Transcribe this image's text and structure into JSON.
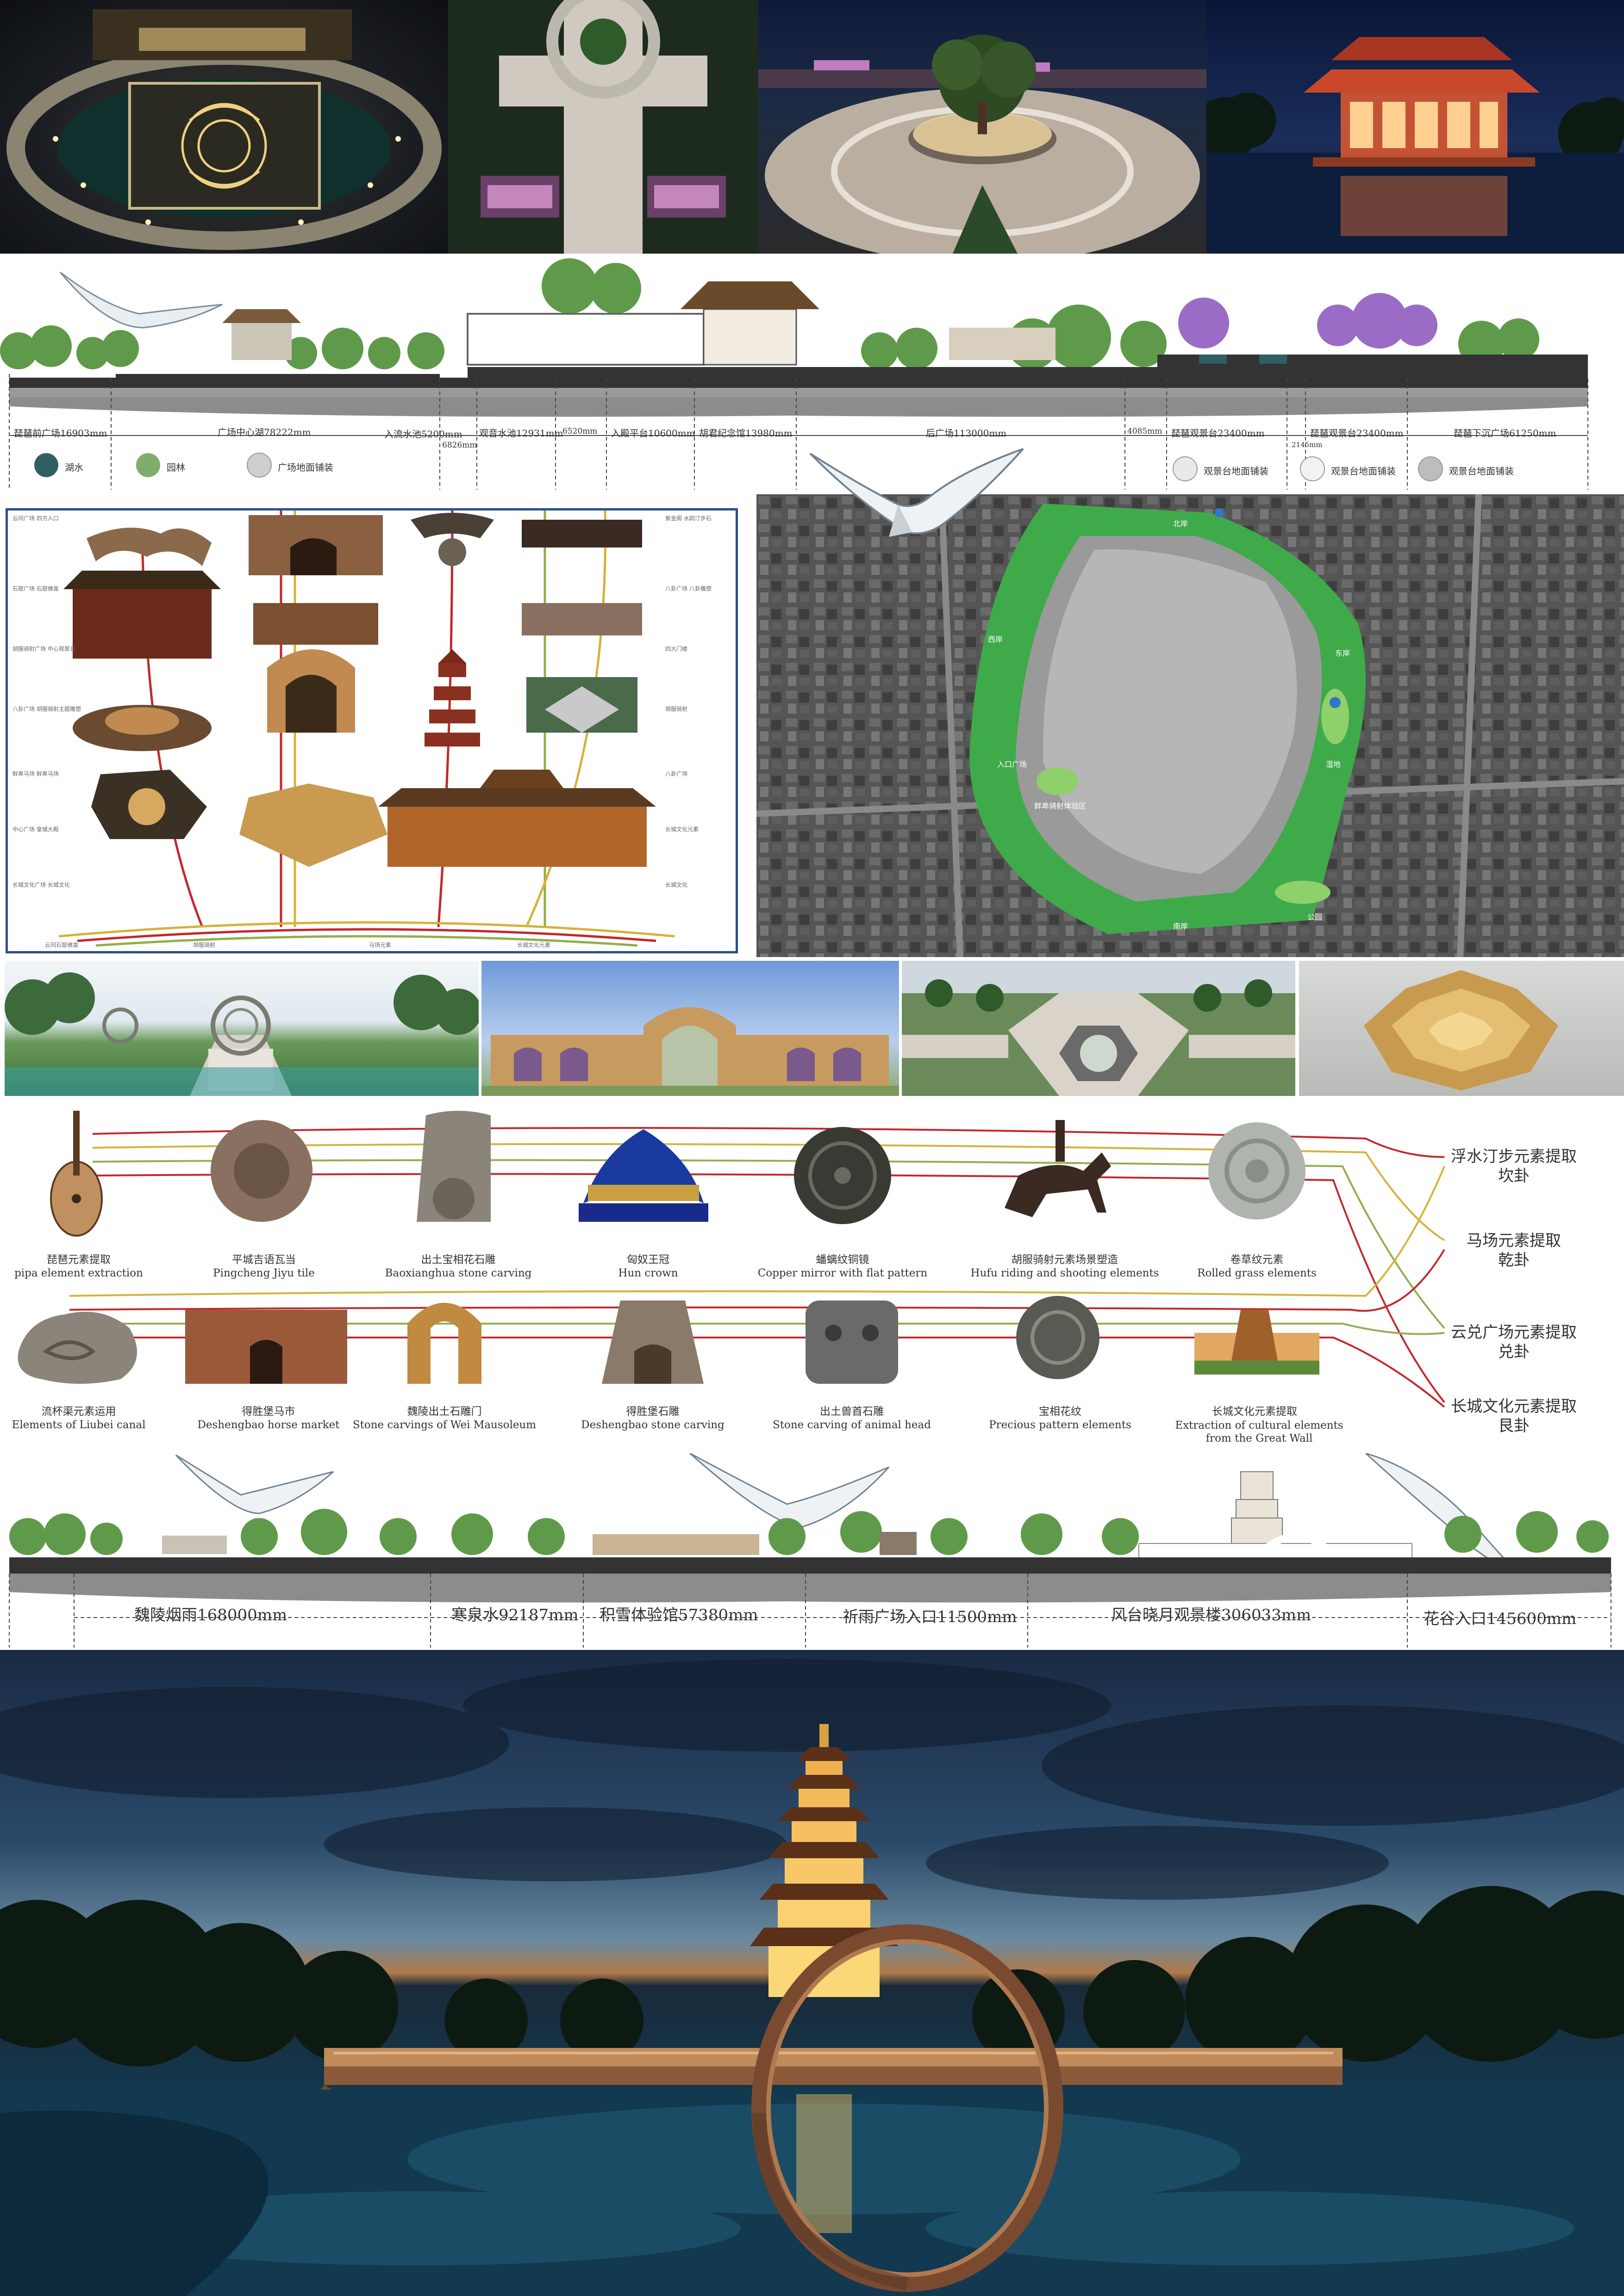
{
  "top_renders": [
    {
      "name": "pipa-plaza-night"
    },
    {
      "name": "axis-walkway-night"
    },
    {
      "name": "round-planter-plaza"
    },
    {
      "name": "red-pavilion-night"
    }
  ],
  "section_top": {
    "labels": [
      "琵琶前广场16903mm",
      "广场中心湖78222mm",
      "入流水池5200mm",
      "6826mm",
      "观音水池12931mm",
      "6520mm",
      "入殿平台10600mm",
      "胡君纪念馆13980mm",
      "后广场113000mm",
      "4085mm",
      "琵琶观景台23400mm",
      "2145mm",
      "琵琶观景台23400mm",
      "琵琶下沉广场61250mm"
    ],
    "legend": [
      {
        "label": "湖水",
        "color": "#2f5f63"
      },
      {
        "label": "园林",
        "color": "#7fae6c"
      },
      {
        "label": "广场地面铺装",
        "color": "#cfcfcf"
      },
      {
        "label": "观景台地面铺装",
        "color": "#e9e9e9"
      },
      {
        "label": "观景台地面铺装",
        "color": "#f2f2f2"
      },
      {
        "label": "观景台地面铺装",
        "color": "#bdbdbd"
      }
    ]
  },
  "element_diagram": {
    "left_labels": [
      "云冈广场 四方入口",
      "石窟广场 石窟佛龛",
      "胡服骑射广场 中心观景台",
      "八卦广场 胡服骑射主题雕塑",
      "鲜卑马场 鲜卑马场",
      "中心广场 皇城大殿",
      "长城文化广场 长城文化"
    ],
    "right_labels": [
      "紫金阁 水韵汀步石",
      "八卦广场 八卦雕塑",
      "四大门楼",
      "胡服骑射",
      "八卦广场",
      "长城文化元素",
      "长城文化"
    ],
    "bottom_labels": [
      "云冈石窟佛龛",
      "胡服骑射",
      "马场元素",
      "长城文化元素"
    ]
  },
  "map": {
    "labels": [
      "东岸",
      "西岸",
      "入口广场",
      "鲜卑骑射体验区",
      "湿地",
      "公园",
      "北岸",
      "南岸"
    ]
  },
  "mid_renders": [
    {
      "name": "armillary-walkway"
    },
    {
      "name": "arched-wall"
    },
    {
      "name": "octagon-plaza"
    },
    {
      "name": "bagua-sculpture"
    }
  ],
  "artifacts_row1": [
    {
      "cn": "琵琶元素提取",
      "en": "pipa element extraction"
    },
    {
      "cn": "平城吉语瓦当",
      "en": "Pingcheng Jiyu tile"
    },
    {
      "cn": "出土宝相花石雕",
      "en": "Baoxianghua stone carving"
    },
    {
      "cn": "匈奴王冠",
      "en": "Hun crown"
    },
    {
      "cn": "蟠螭纹铜镜",
      "en": "Copper mirror with flat pattern"
    },
    {
      "cn": "胡服骑射元素场景塑造",
      "en": "Hufu riding and shooting elements"
    },
    {
      "cn": "卷草纹元素",
      "en": "Rolled grass elements"
    }
  ],
  "artifacts_row2": [
    {
      "cn": "流杯渠元素运用",
      "en": "Elements of Liubei canal"
    },
    {
      "cn": "得胜堡马市",
      "en": "Deshengbao horse market"
    },
    {
      "cn": "魏陵出土石雕门",
      "en": "Stone carvings of Wei Mausoleum"
    },
    {
      "cn": "得胜堡石雕",
      "en": "Deshengbao stone carving"
    },
    {
      "cn": "出土兽首石雕",
      "en": "Stone carving of animal head"
    },
    {
      "cn": "宝相花纹",
      "en": "Precious pattern elements"
    },
    {
      "cn": "长城文化元素提取",
      "en": "Extraction of cultural elements from the Great Wall"
    }
  ],
  "gua": [
    {
      "l1": "浮水汀步元素提取",
      "l2": "坎卦"
    },
    {
      "l1": "马场元素提取",
      "l2": "乾卦"
    },
    {
      "l1": "云兑广场元素提取",
      "l2": "兑卦"
    },
    {
      "l1": "长城文化元素提取",
      "l2": "艮卦"
    }
  ],
  "section_bottom": {
    "labels": [
      "魏陵烟雨168000mm",
      "寒泉水92187mm",
      "积雪体验馆57380mm",
      "祈雨广场入口11500mm",
      "风台晓月观景楼306033mm",
      "花谷入口145600mm"
    ]
  },
  "hero": {
    "name": "pagoda-ring-bridge-night"
  },
  "colors": {
    "sky": "#1b2f4a",
    "water": "#12394f",
    "grass": "#3faa4a",
    "concrete": "#9a9a9a",
    "redline": "#c4272b",
    "yellowline": "#d6b23a",
    "greenline": "#8fb04a",
    "frame": "#2c4f8a"
  }
}
